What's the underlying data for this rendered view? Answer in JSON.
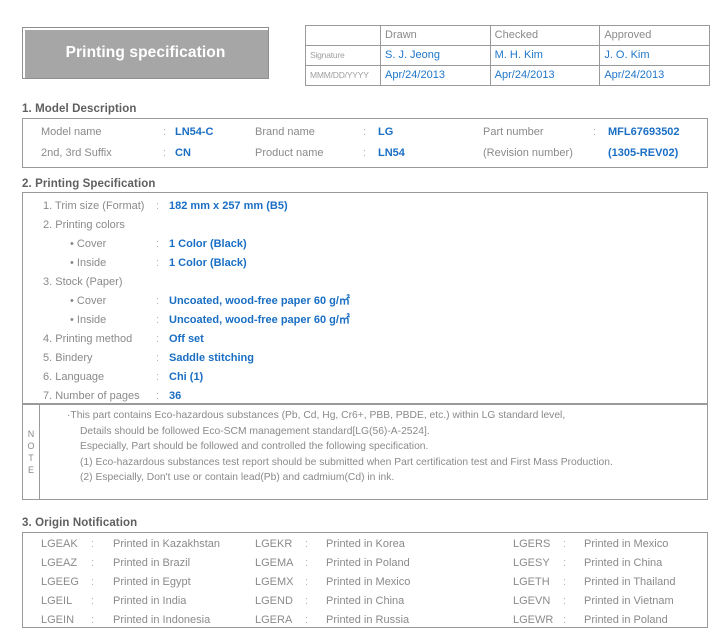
{
  "title_banner": {
    "text": "Printing specification"
  },
  "approval": {
    "columns": [
      "Drawn",
      "Checked",
      "Approved"
    ],
    "row_labels": {
      "signature": "Signature",
      "date": "MMM/DD/YYYY"
    },
    "signatures": [
      "S. J. Jeong",
      "M. H. Kim",
      "J. O. Kim"
    ],
    "dates": [
      "Apr/24/2013",
      "Apr/24/2013",
      "Apr/24/2013"
    ]
  },
  "section1": {
    "heading": "1. Model Description",
    "rows": [
      {
        "c1_label": "Model name",
        "c1_colon": ":",
        "c1_value": "LN54-C",
        "c2_label": "Brand name",
        "c2_colon": ":",
        "c2_value": "LG",
        "c3_label": "Part number",
        "c3_colon": ":",
        "c3_value": "MFL67693502"
      },
      {
        "c1_label": "2nd, 3rd Suffix",
        "c1_colon": ":",
        "c1_value": "CN",
        "c2_label": "Product name",
        "c2_colon": ":",
        "c2_value": "LN54",
        "c3_label": "(Revision number)",
        "c3_colon": "",
        "c3_value": "(1305-REV02)"
      }
    ]
  },
  "section2": {
    "heading": "2. Printing Specification",
    "items": [
      {
        "level": 1,
        "label": "1. Trim size (Format)",
        "colon": ":",
        "value": "182 mm x 257 mm (B5)"
      },
      {
        "level": 1,
        "label": "2. Printing colors",
        "colon": "",
        "value": ""
      },
      {
        "level": 2,
        "label": "• Cover",
        "colon": ":",
        "value": "1 Color (Black)"
      },
      {
        "level": 2,
        "label": "• Inside",
        "colon": ":",
        "value": "1 Color (Black)"
      },
      {
        "level": 1,
        "label": "3. Stock (Paper)",
        "colon": "",
        "value": ""
      },
      {
        "level": 2,
        "label": "• Cover",
        "colon": ":",
        "value": "Uncoated, wood-free paper 60 g/㎡"
      },
      {
        "level": 2,
        "label": "• Inside",
        "colon": ":",
        "value": "Uncoated, wood-free paper 60 g/㎡"
      },
      {
        "level": 1,
        "label": "4. Printing method",
        "colon": ":",
        "value": "Off set"
      },
      {
        "level": 1,
        "label": "5. Bindery",
        "colon": ":",
        "value": "Saddle stitching"
      },
      {
        "level": 1,
        "label": "6. Language",
        "colon": ":",
        "value": "Chi (1)"
      },
      {
        "level": 1,
        "label": "7. Number of pages",
        "colon": ":",
        "value": "36"
      }
    ]
  },
  "note": {
    "vertical_label": [
      "N",
      "O",
      "T",
      "E"
    ],
    "lines": [
      {
        "indent": 0,
        "text": "·This part contains Eco-hazardous substances (Pb, Cd, Hg, Cr6+, PBB, PBDE, etc.) within LG standard level,"
      },
      {
        "indent": 1,
        "text": "Details should be followed Eco-SCM management standard[LG(56)-A-2524]."
      },
      {
        "indent": 1,
        "text": "Especially, Part should be followed and controlled the following specification."
      },
      {
        "indent": 1,
        "text": "(1) Eco-hazardous substances test report should be submitted when Part certification test and First Mass Production."
      },
      {
        "indent": 1,
        "text": "(2) Especially, Don't use or contain lead(Pb) and cadmium(Cd) in ink."
      }
    ]
  },
  "section3": {
    "heading": "3. Origin Notification",
    "rows": [
      {
        "c1_code": "LGEAK",
        "c1_colon": ":",
        "c1_text": "Printed in Kazakhstan",
        "c2_code": "LGEKR",
        "c2_colon": ":",
        "c2_text": "Printed in Korea",
        "c3_code": "LGERS",
        "c3_colon": ":",
        "c3_text": "Printed in Mexico"
      },
      {
        "c1_code": "LGEAZ",
        "c1_colon": ":",
        "c1_text": "Printed in Brazil",
        "c2_code": "LGEMA",
        "c2_colon": ":",
        "c2_text": "Printed in Poland",
        "c3_code": "LGESY",
        "c3_colon": ":",
        "c3_text": "Printed in China"
      },
      {
        "c1_code": "LGEEG",
        "c1_colon": ":",
        "c1_text": "Printed in Egypt",
        "c2_code": "LGEMX",
        "c2_colon": ":",
        "c2_text": "Printed in Mexico",
        "c3_code": "LGETH",
        "c3_colon": ":",
        "c3_text": "Printed in Thailand"
      },
      {
        "c1_code": "LGEIL",
        "c1_colon": ":",
        "c1_text": "Printed in India",
        "c2_code": "LGEND",
        "c2_colon": ":",
        "c2_text": "Printed in China",
        "c3_code": "LGEVN",
        "c3_colon": ":",
        "c3_text": "Printed in Vietnam"
      },
      {
        "c1_code": "LGEIN",
        "c1_colon": ":",
        "c1_text": "Printed in Indonesia",
        "c2_code": "LGERA",
        "c2_colon": ":",
        "c2_text": "Printed in Russia",
        "c3_code": "LGEWR",
        "c3_colon": ":",
        "c3_text": "Printed in Poland"
      }
    ]
  },
  "colors": {
    "banner_bg": "#a6a6a6",
    "value_blue": "#1a6fc4",
    "label_gray": "#8a8a8a",
    "heading_gray": "#5f5f5f",
    "border_gray": "#9a9a9a"
  }
}
